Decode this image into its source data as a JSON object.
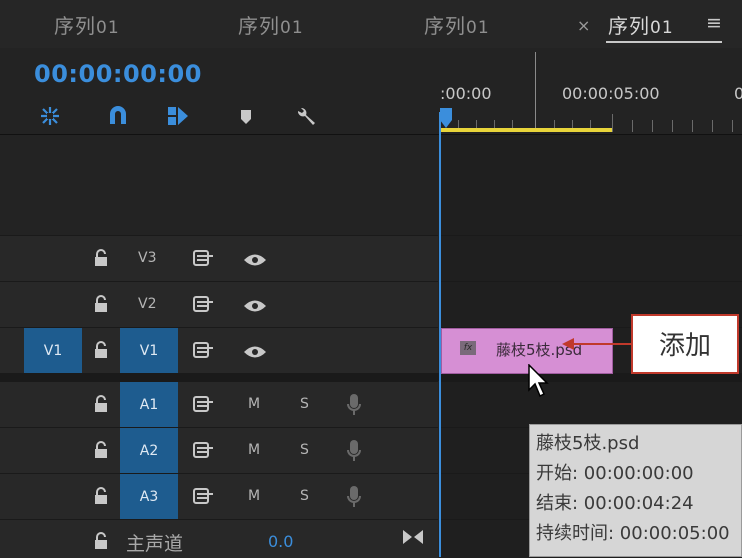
{
  "tabs": [
    {
      "label": "序列",
      "num": "01"
    },
    {
      "label": "序列",
      "num": "01"
    },
    {
      "label": "序列",
      "num": "01"
    },
    {
      "label": "序列",
      "num": "01",
      "active": true
    }
  ],
  "tab_close": "×",
  "tab_menu": "≡",
  "timecode": "00:00:00:00",
  "tools": [
    "ripple-snap-icon",
    "magnet-icon",
    "linked-selection-icon",
    "marker-icon",
    "wrench-icon"
  ],
  "ruler": {
    "start": ":00:00",
    "mark": "00:00:05:00",
    "edge": "0"
  },
  "video_tracks": [
    {
      "name": "V3",
      "source": ""
    },
    {
      "name": "V2",
      "source": ""
    },
    {
      "name": "V1",
      "source": "V1"
    }
  ],
  "audio_tracks": [
    {
      "name": "A1",
      "m": "M",
      "s": "S"
    },
    {
      "name": "A2",
      "m": "M",
      "s": "S"
    },
    {
      "name": "A3",
      "m": "M",
      "s": "S"
    }
  ],
  "master": {
    "label": "主声道",
    "volume": "0.0"
  },
  "clip": {
    "fx": "fx",
    "name": "藤枝5枝.psd",
    "color": "#d68fd4"
  },
  "callout": {
    "text": "添加"
  },
  "tooltip": {
    "title": "藤枝5枝.psd",
    "start": "开始: 00:00:00:00",
    "end": "结束: 00:00:04:24",
    "duration": "持续时间: 00:00:05:00"
  },
  "colors": {
    "accent": "#3b8edc",
    "work_area": "#e8d43a",
    "callout_border": "#c0392b"
  }
}
